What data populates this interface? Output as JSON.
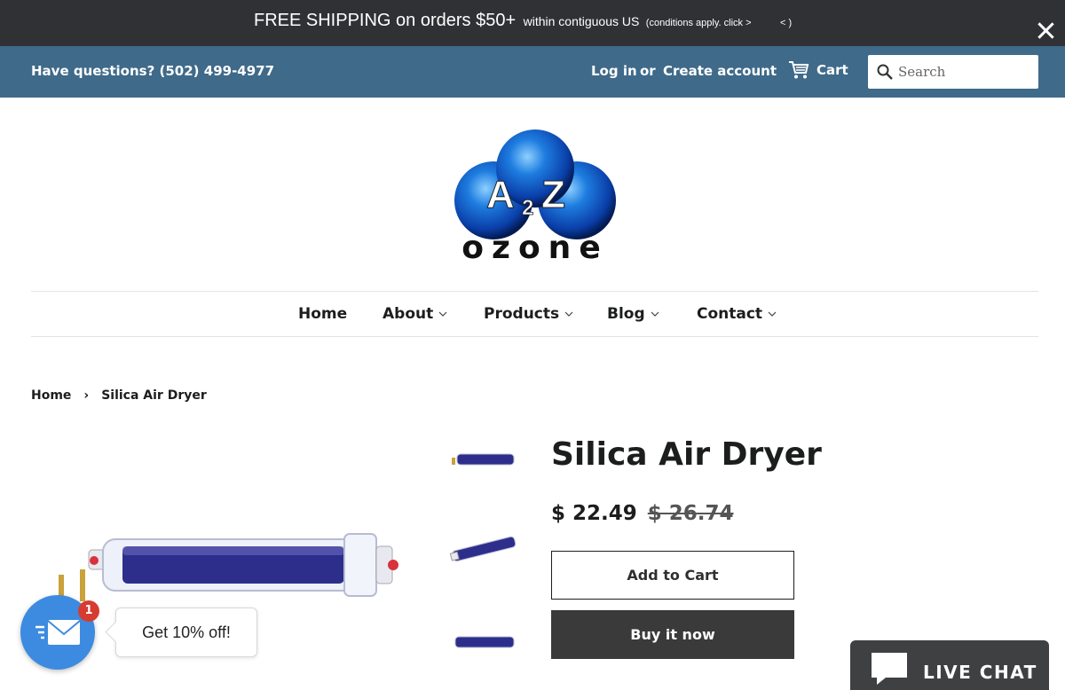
{
  "announcement": {
    "main": "FREE SHIPPING on orders $50+",
    "sub": "within contiguous US",
    "small": "(conditions apply. click  >",
    "arrows": "< )"
  },
  "topbar": {
    "phone": "Have questions? (502) 499-4977",
    "login": "Log in",
    "or": "or",
    "create_account": "Create account",
    "cart": "Cart",
    "search_placeholder": "Search"
  },
  "logo": {
    "text_top": "A2Z",
    "text_bottom": "ozone"
  },
  "nav": {
    "items": [
      {
        "label": "Home",
        "dropdown": false
      },
      {
        "label": "About",
        "dropdown": true
      },
      {
        "label": "Products",
        "dropdown": true
      },
      {
        "label": "Blog",
        "dropdown": true
      },
      {
        "label": "Contact",
        "dropdown": true
      }
    ]
  },
  "breadcrumb": {
    "home": "Home",
    "separator": "›",
    "current": "Silica Air Dryer"
  },
  "product": {
    "title": "Silica Air Dryer",
    "price": "$ 22.49",
    "compare_price": "$ 26.74",
    "add_to_cart": "Add to Cart",
    "buy_now": "Buy it now"
  },
  "promo": {
    "badge": "1",
    "text": "Get 10% off!"
  },
  "live_chat": {
    "label": "LIVE CHAT"
  },
  "colors": {
    "announcement_bg": "#303135",
    "topbar_bg": "#3f6a8a",
    "buy_now_bg": "#3a3a3a",
    "promo_blue": "#3c8be0",
    "badge_red": "#d63c2f",
    "live_chat_bg": "#3f4042"
  }
}
